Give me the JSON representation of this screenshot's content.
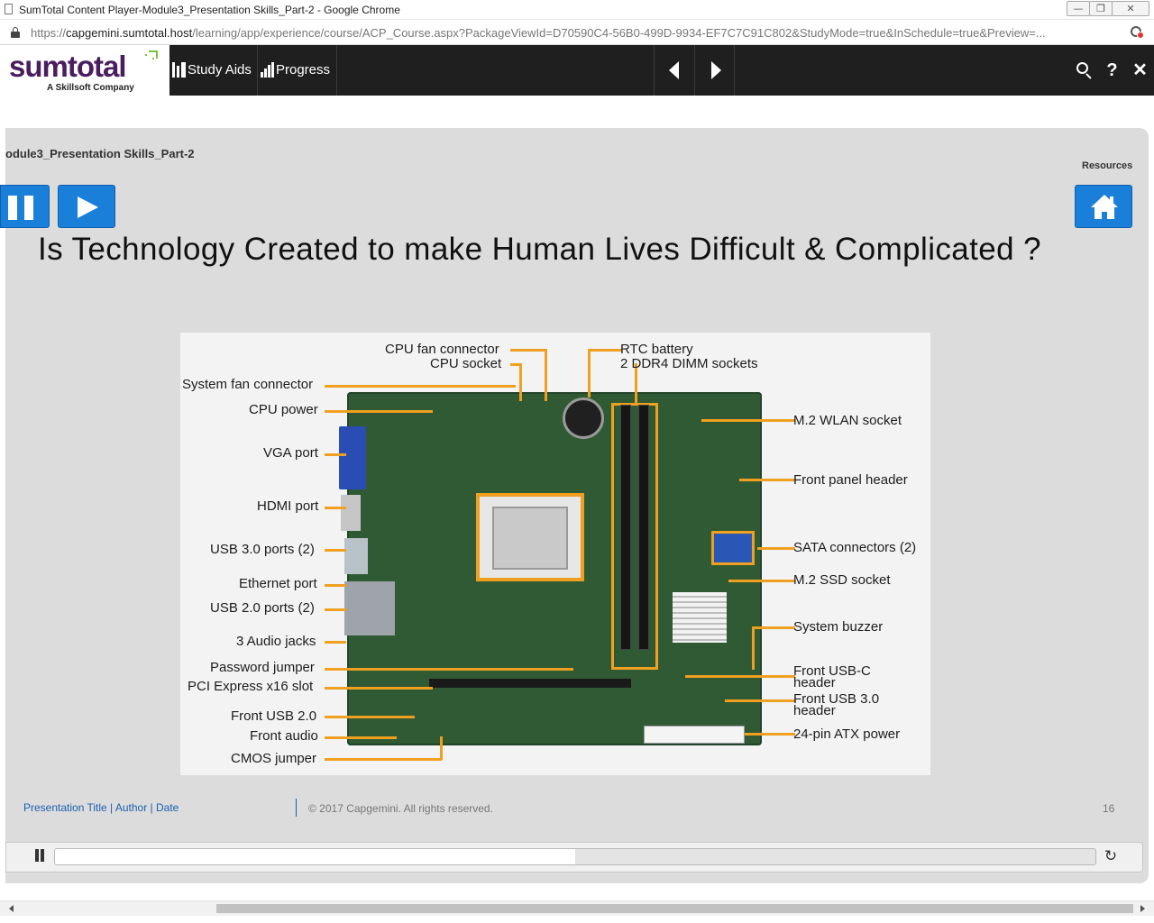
{
  "window": {
    "title": "SumTotal Content Player-Module3_Presentation Skills_Part-2 - Google Chrome",
    "minimize_glyph": "—",
    "maximize_glyph": "❐",
    "close_glyph": "✕"
  },
  "address_bar": {
    "url_prefix": "https://",
    "url_host": "capgemini.sumtotal.host",
    "url_rest": "/learning/app/experience/course/ACP_Course.aspx?PackageViewId=D70590C4-56B0-499D-9934-EF7C7C91C802&StudyMode=true&InSchedule=true&Preview=..."
  },
  "app_header": {
    "logo_text": "sumtotal",
    "logo_tagline": "A Skillsoft Company",
    "nav": [
      {
        "label": "Study Aids",
        "icon": "study-aids-icon"
      },
      {
        "label": "Progress",
        "icon": "progress-bars-icon"
      }
    ],
    "icons": [
      "search-icon",
      "help-icon",
      "close-icon"
    ],
    "help_glyph": "?",
    "close_glyph": "✕"
  },
  "player": {
    "course_title": "odule3_Presentation Skills_Part-2",
    "resources_label": "Resources",
    "slide_heading": "Is Technology Created to make Human Lives Difficult & Complicated ?",
    "footer_left": "Presentation Title | Author | Date",
    "footer_copyright": "© 2017 Capgemini. All rights reserved.",
    "page_number": "16",
    "progress_fraction": 0.5,
    "replay_glyph": "↻"
  },
  "motherboard_labels": {
    "cpu_fan_connector": "CPU fan connector",
    "cpu_socket": "CPU socket",
    "rtc_battery": "RTC battery",
    "ddr4_dimm": "2 DDR4 DIMM sockets",
    "system_fan_connector": "System fan connector",
    "cpu_power": "CPU power",
    "vga_port": "VGA port",
    "hdmi_port": "HDMI port",
    "usb30_ports": "USB 3.0 ports (2)",
    "ethernet_port": "Ethernet port",
    "usb20_ports": "USB 2.0 ports (2)",
    "audio_jacks": "3 Audio jacks",
    "password_jumper": "Password jumper",
    "pci_express": "PCI Express x16 slot",
    "front_usb20": "Front USB 2.0",
    "front_audio": "Front audio",
    "cmos_jumper": "CMOS jumper",
    "m2_wlan": "M.2 WLAN socket",
    "front_panel_header": "Front panel header",
    "sata_connectors": "SATA connectors (2)",
    "m2_ssd": "M.2 SSD socket",
    "system_buzzer": "System buzzer",
    "front_usbc_1": "Front USB-C",
    "front_usbc_2": "header",
    "front_usb30_1": "Front USB 3.0",
    "front_usb30_2": "header",
    "atx_power": "24-pin ATX power"
  },
  "colors": {
    "accent_blue": "#1a7fd9",
    "header_bg": "#1f1f1f",
    "logo_purple": "#4a1d5f",
    "callout_orange": "#f0a020"
  }
}
